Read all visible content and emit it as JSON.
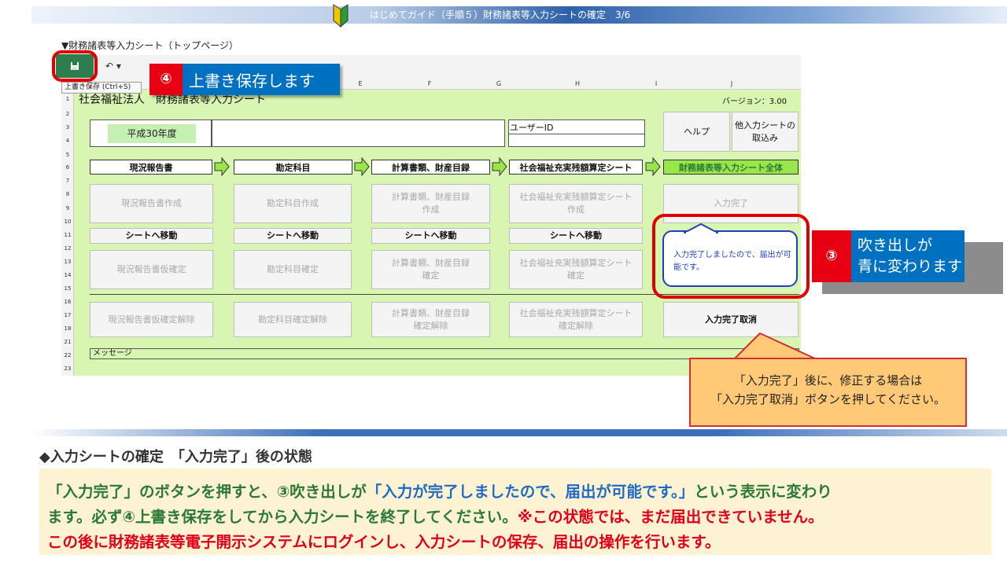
{
  "header": {
    "title": "はじめてガイド（手順５）財務諸表等入力シートの確定　3/6"
  },
  "page_label": "▼財務諸表等入力シート（トップページ）",
  "toolbar": {
    "save_tooltip": "上書き保存 (Ctrl+S)",
    "undo_label": "↶ ▾"
  },
  "columns": [
    "E",
    "F",
    "G",
    "H",
    "I",
    "J"
  ],
  "rows": [
    "1",
    "2",
    "3",
    "4",
    "5",
    "6",
    "7",
    "8",
    "9",
    "10",
    "11",
    "12",
    "13",
    "14",
    "15",
    "16",
    "17",
    "18",
    "21",
    "22",
    "23"
  ],
  "sheet": {
    "title": "社会福祉法人　財務諸表等入力シート",
    "version": "バージョン：3.00",
    "fiscal_year": "平成30年度",
    "user_id_label": "ユーザーID",
    "help_button": "ヘルプ",
    "import_button": "他入力シートの\n取込み",
    "headers": [
      "現況報告書",
      "勘定科目",
      "計算書類、財産目録",
      "社会福祉充実残額算定シート",
      "財務諸表等入力シート全体"
    ],
    "create_buttons": [
      "現況報告書作成",
      "勘定科目作成",
      "計算書類、財産目録\n作成",
      "社会福祉充実残額算定シート\n作成",
      "入力完了"
    ],
    "move_buttons": [
      "シートへ移動",
      "シートへ移動",
      "シートへ移動",
      "シートへ移動"
    ],
    "confirm_buttons": [
      "現況報告書仮確定",
      "勘定科目確定",
      "計算書類、財産目録\n確定",
      "社会福祉充実残額算定シート\n確定"
    ],
    "release_buttons": [
      "現況報告書仮確定解除",
      "勘定科目確定解除",
      "計算書類、財産目録\n確定解除",
      "社会福祉充実残額算定シート\n確定解除",
      "入力完了取消"
    ],
    "message_label": "メッセージ",
    "balloon_text": "入力完了しましたので、届出が可能です。"
  },
  "callouts": {
    "save": {
      "badge": "④",
      "text": "上書き保存します"
    },
    "balloon": {
      "badge": "③",
      "text_line1": "吹き出しが",
      "text_line2": "青に変わります"
    },
    "note_line1": "「入力完了」後に、修正する場合は",
    "note_line2": "「入力完了取消」ボタンを押してください。"
  },
  "section": {
    "title": "◆入力シートの確定　「入力完了」後の状態",
    "p1a": "「入力完了」のボタンを押すと、③吹き出しが",
    "p1b": "「入力が完了しましたので、届出が可能です。」",
    "p1c": "という表示に変わり",
    "p2a": "ます。必ず④上書き保存をしてから入力シートを終了してください。",
    "p2b": "※この状態では、まだ届出できていません。",
    "p3": "この後に財務諸表等電子開示システムにログインし、入力シートの保存、届出の操作を行います。"
  },
  "colors": {
    "accent_blue": "#0070c0",
    "badge_red": "#e60012",
    "sheet_green": "#d9f5b2",
    "note_orange": "#ffc977"
  }
}
